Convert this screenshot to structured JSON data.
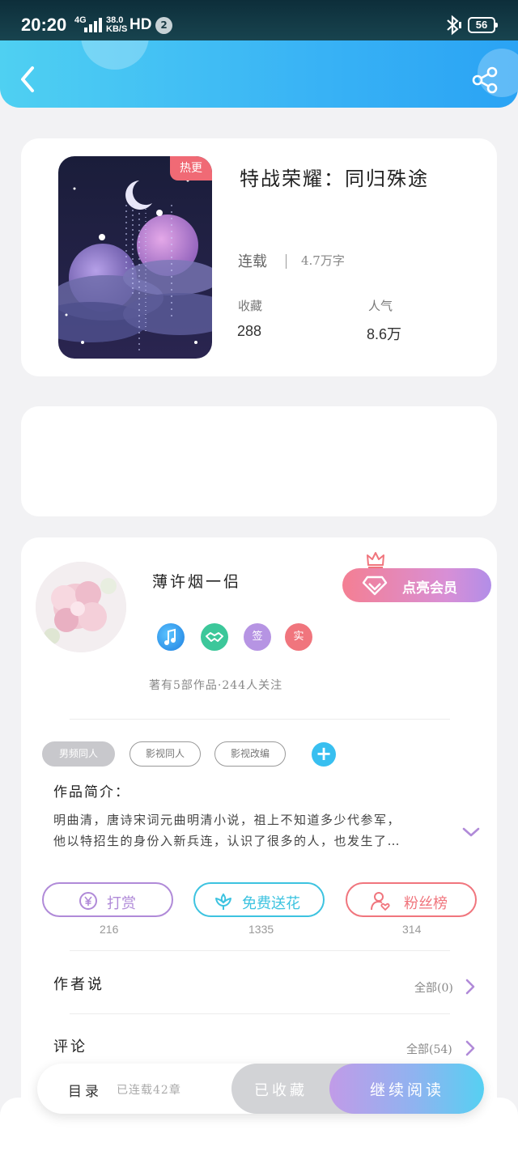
{
  "status_bar": {
    "time": "20:20",
    "network": "4G",
    "speed_value": "38.0",
    "speed_unit": "KB/S",
    "hd": "HD",
    "notifications": "2",
    "battery": "56"
  },
  "book": {
    "title": "特战荣耀：同归殊途",
    "badge": "热更",
    "status": "连载",
    "word_count": "4.7万字",
    "stats": [
      {
        "label": "收藏",
        "value": "288"
      },
      {
        "label": "人气",
        "value": "8.6万"
      }
    ]
  },
  "author": {
    "name": "薄许烟一侣",
    "vip_button": "点亮会员",
    "badges": [
      {
        "text": "",
        "icon": "music-note-icon",
        "color": "#2a9df0"
      },
      {
        "text": "",
        "icon": "handshake-icon",
        "color": "#3cc79a"
      },
      {
        "text": "签",
        "icon": "",
        "color": "#b694e3"
      },
      {
        "text": "实",
        "icon": "",
        "color": "#f0757d"
      }
    ],
    "meta": "著有5部作品·244人关注"
  },
  "tags": [
    "男频同人",
    "影视同人",
    "影视改编"
  ],
  "intro": {
    "title": "作品简介：",
    "lines": [
      "明曲清，唐诗宋词元曲明清小说，祖上不知道多少代参军，",
      "他以特招生的身份入新兵连，认识了很多的人，也发生了…"
    ]
  },
  "actions": [
    {
      "label": "打赏",
      "count": "216",
      "color": "#b08ad8",
      "icon": "yen-coin-icon"
    },
    {
      "label": "免费送花",
      "count": "1335",
      "color": "#3dc3e0",
      "icon": "flower-icon"
    },
    {
      "label": "粉丝榜",
      "count": "314",
      "color": "#f0757d",
      "icon": "fan-user-icon"
    }
  ],
  "sections": [
    {
      "title": "作者说",
      "more": "全部(0)"
    },
    {
      "title": "评论",
      "more": "全部(54)"
    }
  ],
  "bottom_bar": {
    "toc_label": "目录",
    "progress": "已连载42章",
    "collect": "已收藏",
    "read": "继续阅读"
  }
}
